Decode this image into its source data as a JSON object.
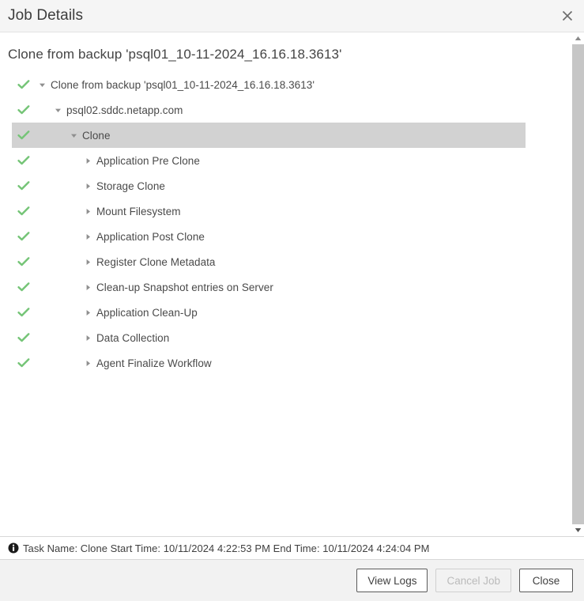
{
  "window": {
    "title": "Job Details",
    "close_icon": "close-icon"
  },
  "job": {
    "heading": "Clone from backup 'psql01_10-11-2024_16.16.18.3613'"
  },
  "tree": {
    "nodes": [
      {
        "label": "Clone from backup 'psql01_10-11-2024_16.16.18.3613'",
        "indent": 0,
        "status": "success",
        "expanded": true,
        "selected": false,
        "twisty": "chevron-down-icon"
      },
      {
        "label": "psql02.sddc.netapp.com",
        "indent": 1,
        "status": "success",
        "expanded": true,
        "selected": false,
        "twisty": "chevron-down-icon"
      },
      {
        "label": "Clone",
        "indent": 2,
        "status": "success",
        "expanded": true,
        "selected": true,
        "twisty": "chevron-down-icon"
      },
      {
        "label": "Application Pre Clone",
        "indent": 3,
        "status": "success",
        "expanded": false,
        "selected": false,
        "twisty": "chevron-right-icon"
      },
      {
        "label": "Storage Clone",
        "indent": 3,
        "status": "success",
        "expanded": false,
        "selected": false,
        "twisty": "chevron-right-icon"
      },
      {
        "label": "Mount Filesystem",
        "indent": 3,
        "status": "success",
        "expanded": false,
        "selected": false,
        "twisty": "chevron-right-icon"
      },
      {
        "label": "Application Post Clone",
        "indent": 3,
        "status": "success",
        "expanded": false,
        "selected": false,
        "twisty": "chevron-right-icon"
      },
      {
        "label": "Register Clone Metadata",
        "indent": 3,
        "status": "success",
        "expanded": false,
        "selected": false,
        "twisty": "chevron-right-icon"
      },
      {
        "label": "Clean-up Snapshot entries on Server",
        "indent": 3,
        "status": "success",
        "expanded": false,
        "selected": false,
        "twisty": "chevron-right-icon"
      },
      {
        "label": "Application Clean-Up",
        "indent": 3,
        "status": "success",
        "expanded": false,
        "selected": false,
        "twisty": "chevron-right-icon"
      },
      {
        "label": "Data Collection",
        "indent": 3,
        "status": "success",
        "expanded": false,
        "selected": false,
        "twisty": "chevron-right-icon"
      },
      {
        "label": "Agent Finalize Workflow",
        "indent": 3,
        "status": "success",
        "expanded": false,
        "selected": false,
        "twisty": "chevron-right-icon"
      }
    ]
  },
  "scrollbar": {
    "up_icon": "scroll-up-arrow-icon",
    "down_icon": "scroll-down-arrow-icon"
  },
  "statusbar": {
    "icon": "info-icon",
    "text": "Task Name: Clone Start Time: 10/11/2024 4:22:53 PM End Time: 10/11/2024 4:24:04 PM"
  },
  "footer": {
    "view_logs_label": "View Logs",
    "cancel_job_label": "Cancel Job",
    "close_label": "Close"
  },
  "colors": {
    "success_check": "#74c476",
    "selected_row": "#d2d2d2",
    "titlebar_bg": "#f5f5f5",
    "footer_bg": "#f2f2f2",
    "scrollbar_track": "#c6c6c6"
  }
}
